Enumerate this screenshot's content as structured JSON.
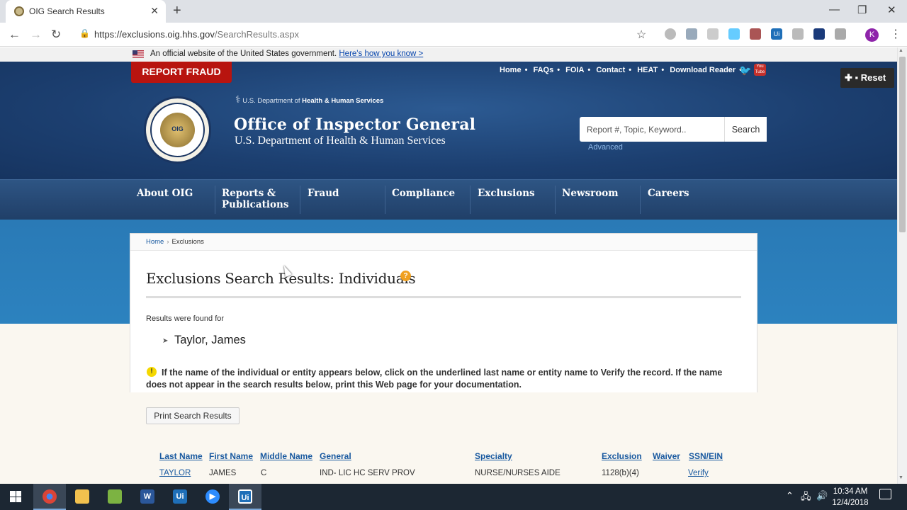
{
  "browser": {
    "tab_title": "OIG Search Results",
    "url_host": "https://exclusions.oig.hhs.gov",
    "url_path": "/SearchResults.aspx",
    "new_tab_icon": "+",
    "profile_initial": "K"
  },
  "gov_banner": {
    "text": "An official website of the United States government.",
    "link": "Here's how you know >"
  },
  "header": {
    "report_fraud": "REPORT FRAUD",
    "top_links": [
      "Home",
      "FAQs",
      "FOIA",
      "Contact",
      "HEAT",
      "Download Reader"
    ],
    "reset_label": "Reset",
    "hhs_prefix": "U.S. Department of",
    "hhs_bold": "Health & Human Services",
    "seal_text": "OIG",
    "title": "Office of Inspector General",
    "subtitle": "U.S. Department of Health & Human Services",
    "search_placeholder": "Report #, Topic, Keyword..",
    "search_button": "Search",
    "advanced": "Advanced"
  },
  "nav": {
    "items": [
      "About OIG",
      "Reports &\nPublications",
      "Fraud",
      "Compliance",
      "Exclusions",
      "Newsroom",
      "Careers"
    ]
  },
  "breadcrumb": {
    "home": "Home",
    "current": "Exclusions"
  },
  "main": {
    "title": "Exclusions Search Results: Individuals",
    "results_label": "Results were found for",
    "result_name": "Taylor, James",
    "notice": "If the name of the individual or entity appears below, click on the underlined last name or entity name to Verify the record. If the name does not appear in the search results below, print this Web page for your documentation.",
    "print_button": "Print Search Results",
    "table": {
      "headers": [
        "Last Name",
        "First Name",
        "Middle Name",
        "General",
        "Specialty",
        "Exclusion",
        "Waiver",
        "SSN/EIN"
      ],
      "rows": [
        [
          "TAYLOR",
          "JAMES",
          "C",
          "IND- LIC HC SERV PROV",
          "NURSE/NURSES AIDE",
          "1128(b)(4)",
          "",
          "Verify"
        ]
      ]
    }
  },
  "taskbar": {
    "apps": [
      "chrome",
      "file-explorer",
      "notepad",
      "word",
      "uipath",
      "zoom",
      "uipath-studio"
    ],
    "time": "10:34 AM",
    "date": "12/4/2018"
  },
  "colors": {
    "header_blue": "#1c3f70",
    "report_red": "#b8140f",
    "link_blue": "#1a5aa0",
    "page_blue": "#2a7ab6"
  }
}
